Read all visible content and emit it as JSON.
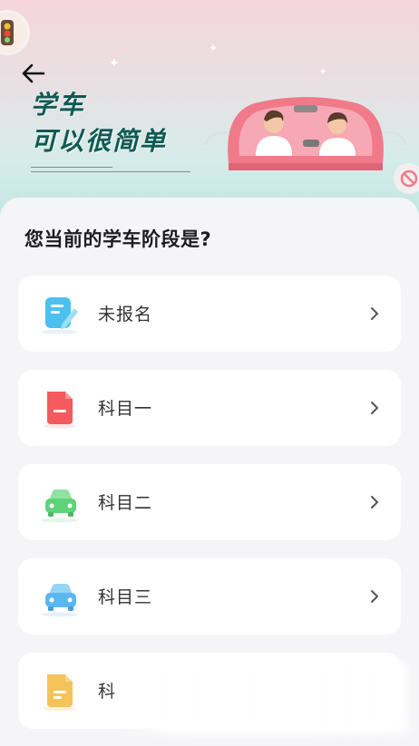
{
  "header": {
    "slogan_line1": "学车",
    "slogan_line2": "可以很简单"
  },
  "question": "您当前的学车阶段是?",
  "stages": [
    {
      "label": "未报名",
      "icon": "notebook-pen-icon",
      "color": "#4cc0ee"
    },
    {
      "label": "科目一",
      "icon": "document-icon",
      "color": "#f45b5f"
    },
    {
      "label": "科目二",
      "icon": "car-icon",
      "color": "#5fd37a"
    },
    {
      "label": "科目三",
      "icon": "car-icon",
      "color": "#5ab8f0"
    },
    {
      "label": "科",
      "icon": "document-icon",
      "color": "#f6c35a"
    }
  ],
  "colors": {
    "brand_green": "#0f5a53",
    "car_pink": "#f27b8c",
    "background": "#f5f5f7"
  }
}
